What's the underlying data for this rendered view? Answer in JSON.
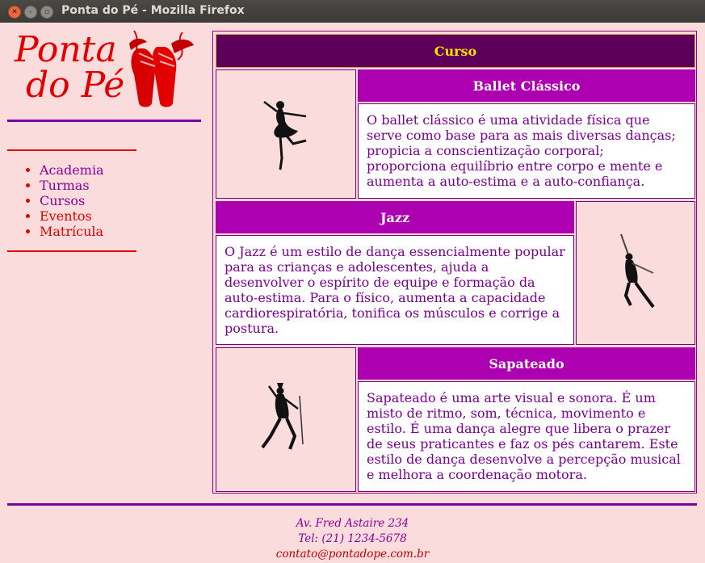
{
  "window": {
    "title": "Ponta do Pé - Mozilla Firefox"
  },
  "logo": {
    "line1": "Ponta",
    "line2": "do Pé"
  },
  "nav": {
    "items": [
      {
        "label": "Academia"
      },
      {
        "label": "Turmas"
      },
      {
        "label": "Cursos"
      },
      {
        "label": "Eventos"
      },
      {
        "label": "Matrícula"
      }
    ]
  },
  "content": {
    "header": "Curso",
    "courses": [
      {
        "title": "Ballet Clássico",
        "description": "O ballet clássico é uma atividade física que serve como base para as mais diversas danças; propicia a conscientização corporal; proporciona equilíbrio entre corpo e mente e aumenta a auto-estima e a auto-confiança."
      },
      {
        "title": "Jazz",
        "description": "O Jazz é um estilo de dança essencialmente popular para as crianças e adolescentes, ajuda a desenvolver o espírito de equipe e formação da auto-estima. Para o físico, aumenta a capacidade cardiorespiratória, tonifica os músculos e corrige a postura."
      },
      {
        "title": "Sapateado",
        "description": "Sapateado é uma arte visual e sonora. É um misto de ritmo, som, técnica, movimento e estilo. É uma dança alegre que libera o prazer de seus praticantes e faz os pés cantarem. Este estilo de dança desenvolve a percepção musical e melhora a coordenação motora."
      }
    ]
  },
  "footer": {
    "address": "Av. Fred Astaire 234",
    "phone": "Tel: (21) 1234-5678",
    "email": "contato@pontadope.com.br"
  },
  "colors": {
    "background": "#fbdcdc",
    "accent": "#ad00b1",
    "header_bg": "#5c005b",
    "header_text": "#ffe400",
    "nav_red": "#e00000"
  }
}
